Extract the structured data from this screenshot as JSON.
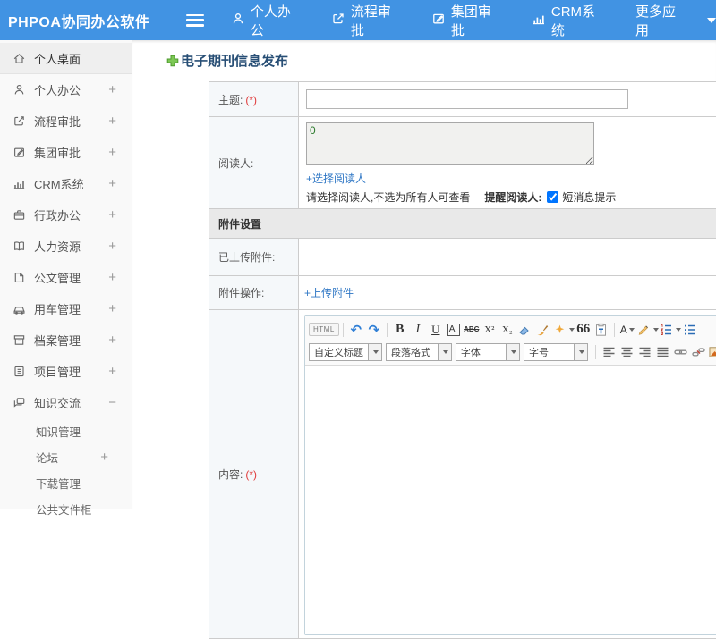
{
  "colors": {
    "header_bg": "#4193e3",
    "link": "#2f77c5",
    "title": "#274e75",
    "required": "#e03a3a",
    "section_bg": "#e9e9e9",
    "plus_green": "#7dc855"
  },
  "header": {
    "logo": "PHPOA协同办公软件",
    "nav": [
      {
        "label": "个人办公",
        "icon": "person-icon"
      },
      {
        "label": "流程审批",
        "icon": "flow-icon"
      },
      {
        "label": "集团审批",
        "icon": "edit-icon"
      },
      {
        "label": "CRM系统",
        "icon": "chart-icon"
      },
      {
        "label": "更多应用",
        "icon": "caret-down-icon"
      }
    ]
  },
  "sidebar": {
    "items": [
      {
        "label": "个人桌面",
        "icon": "home-icon",
        "active": true
      },
      {
        "label": "个人办公",
        "icon": "person-icon",
        "expand": "+"
      },
      {
        "label": "流程审批",
        "icon": "flow-icon",
        "expand": "+"
      },
      {
        "label": "集团审批",
        "icon": "edit-icon",
        "expand": "+"
      },
      {
        "label": "CRM系统",
        "icon": "chart-icon",
        "expand": "+"
      },
      {
        "label": "行政办公",
        "icon": "briefcase-icon",
        "expand": "+"
      },
      {
        "label": "人力资源",
        "icon": "book-icon",
        "expand": "+"
      },
      {
        "label": "公文管理",
        "icon": "document-icon",
        "expand": "+"
      },
      {
        "label": "用车管理",
        "icon": "car-icon",
        "expand": "+"
      },
      {
        "label": "档案管理",
        "icon": "archive-icon",
        "expand": "+"
      },
      {
        "label": "项目管理",
        "icon": "notebook-icon",
        "expand": "+"
      },
      {
        "label": "知识交流",
        "icon": "chat-icon",
        "expand": "−"
      }
    ],
    "subitems": [
      {
        "label": "知识管理"
      },
      {
        "label": "论坛",
        "expand": "+"
      },
      {
        "label": "下载管理"
      },
      {
        "label": "公共文件柜"
      }
    ]
  },
  "main": {
    "page_title": "电子期刊信息发布",
    "form": {
      "subject_label": "主题:",
      "required_mark": "(*)",
      "readers_label": "阅读人:",
      "readers_value": "0",
      "select_readers_link": "+选择阅读人",
      "readers_hint": "请选择阅读人,不选为所有人可查看",
      "remind_label": "提醒阅读人:",
      "sms_checkbox_label": "短消息提示",
      "sms_checked": true,
      "attachment_section": "附件设置",
      "uploaded_label": "已上传附件:",
      "attachment_op_label": "附件操作:",
      "upload_link": "+上传附件",
      "content_label": "内容:"
    },
    "editor": {
      "html_label": "HTML",
      "bold": "B",
      "italic": "I",
      "underline": "U",
      "font_box": "A",
      "strike": "ABC",
      "superscript": "X²",
      "subscript": "X₂",
      "quote": "66",
      "font_color": "A",
      "dropdowns": [
        "自定义标题",
        "段落格式",
        "字体",
        "字号"
      ]
    }
  }
}
